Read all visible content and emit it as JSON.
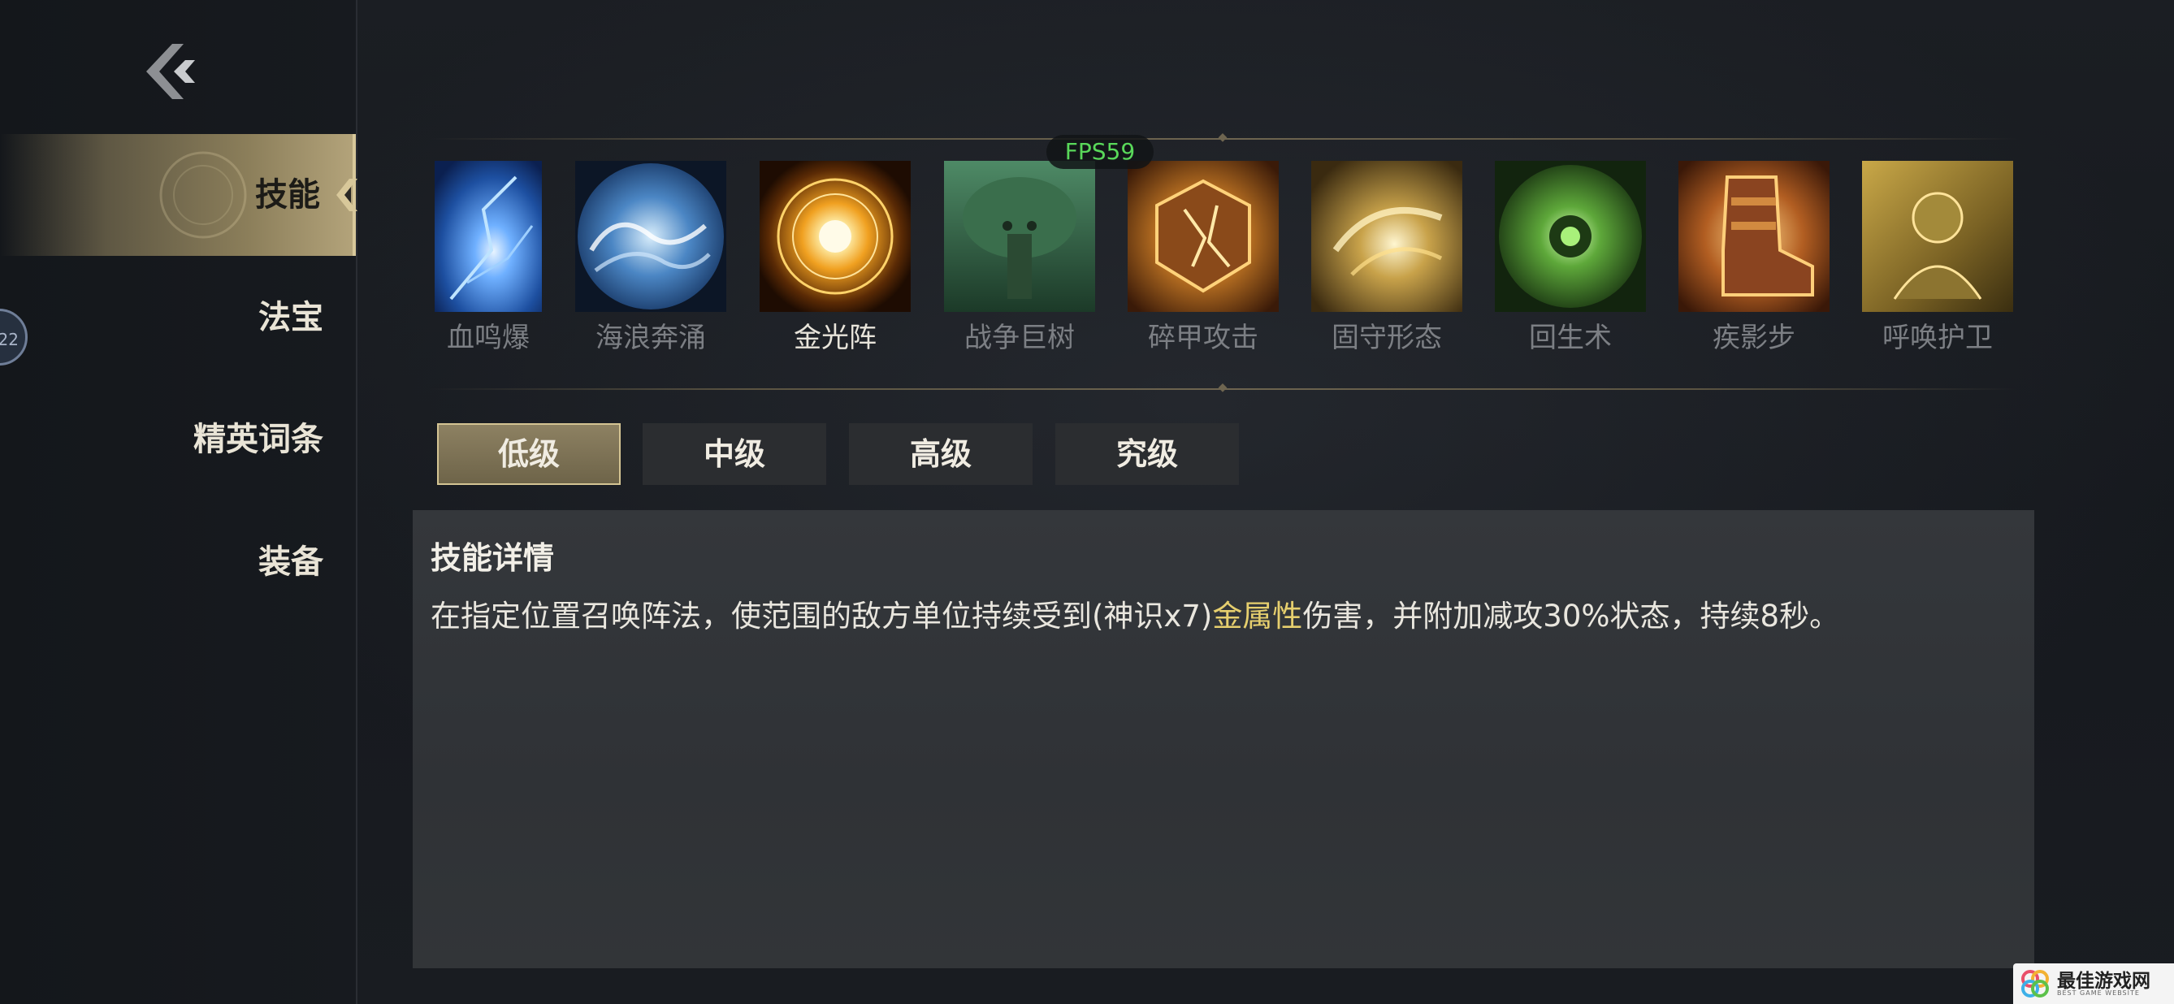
{
  "hud": {
    "fps": "FPS59"
  },
  "sidebar": {
    "avatar_level": "22",
    "items": [
      {
        "label": "技能",
        "active": true
      },
      {
        "label": "法宝",
        "active": false
      },
      {
        "label": "精英词条",
        "active": false
      },
      {
        "label": "装备",
        "active": false
      }
    ]
  },
  "skills": [
    {
      "name": "血鸣爆",
      "icon": "blue-burst-icon",
      "selected": false
    },
    {
      "name": "海浪奔涌",
      "icon": "wave-icon",
      "selected": false
    },
    {
      "name": "金光阵",
      "icon": "golden-array-icon",
      "selected": true
    },
    {
      "name": "战争巨树",
      "icon": "war-tree-icon",
      "selected": false
    },
    {
      "name": "碎甲攻击",
      "icon": "armor-break-icon",
      "selected": false
    },
    {
      "name": "固守形态",
      "icon": "guard-stance-icon",
      "selected": false
    },
    {
      "name": "回生术",
      "icon": "revive-icon",
      "selected": false
    },
    {
      "name": "疾影步",
      "icon": "shadow-step-boot-icon",
      "selected": false
    },
    {
      "name": "呼唤护卫",
      "icon": "summon-guard-icon",
      "selected": false
    }
  ],
  "tiers": [
    {
      "label": "低级",
      "active": true
    },
    {
      "label": "中级",
      "active": false
    },
    {
      "label": "高级",
      "active": false
    },
    {
      "label": "究级",
      "active": false
    }
  ],
  "detail": {
    "title": "技能详情",
    "text_before": "在指定位置召唤阵法，使范围的敌方单位持续受到(神识x7)",
    "text_highlight": "金属性",
    "text_after": "伤害，并附加减攻30%状态，持续8秒。"
  },
  "watermark": {
    "title": "最佳游戏网",
    "subtitle": "BEST GAME WEBSITE"
  },
  "colors": {
    "accent_gold": "#b3a37a",
    "highlight_text": "#e6cf6e",
    "fps_green": "#59d85a"
  }
}
